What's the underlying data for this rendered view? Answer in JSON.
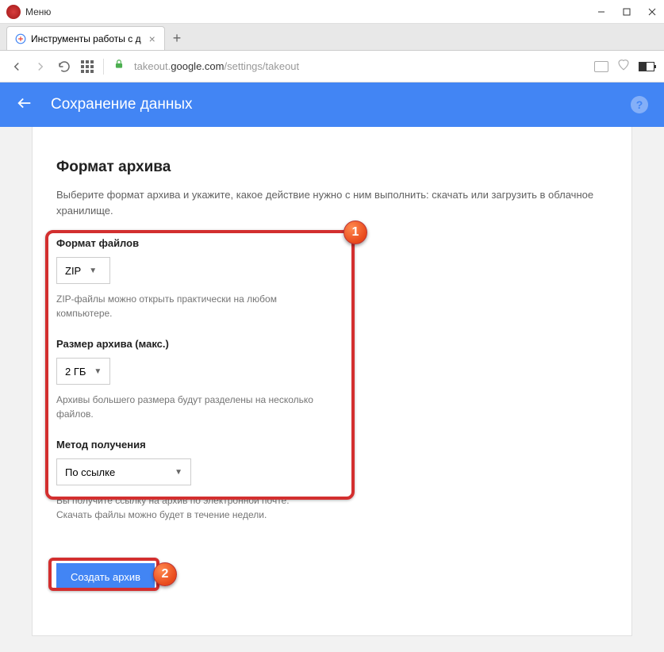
{
  "window": {
    "menu_label": "Меню"
  },
  "tab": {
    "title": "Инструменты работы с д"
  },
  "addressbar": {
    "url_prefix": "takeout.",
    "url_domain": "google.com",
    "url_suffix": "/settings/takeout"
  },
  "header": {
    "title": "Сохранение данных"
  },
  "section": {
    "title": "Формат архива",
    "description": "Выберите формат архива и укажите, какое действие нужно с ним выполнить: скачать или загрузить в облачное хранилище."
  },
  "fields": {
    "file_format": {
      "label": "Формат файлов",
      "value": "ZIP",
      "hint": "ZIP-файлы можно открыть практически на любом компьютере."
    },
    "archive_size": {
      "label": "Размер архива (макс.)",
      "value": "2 ГБ",
      "hint": "Архивы большего размера будут разделены на несколько файлов."
    },
    "delivery": {
      "label": "Метод получения",
      "value": "По ссылке",
      "hint": "Вы получите ссылку на архив по электронной почте. Скачать файлы можно будет в течение недели."
    }
  },
  "create_button": "Создать архив",
  "annotations": {
    "badge1": "1",
    "badge2": "2"
  }
}
